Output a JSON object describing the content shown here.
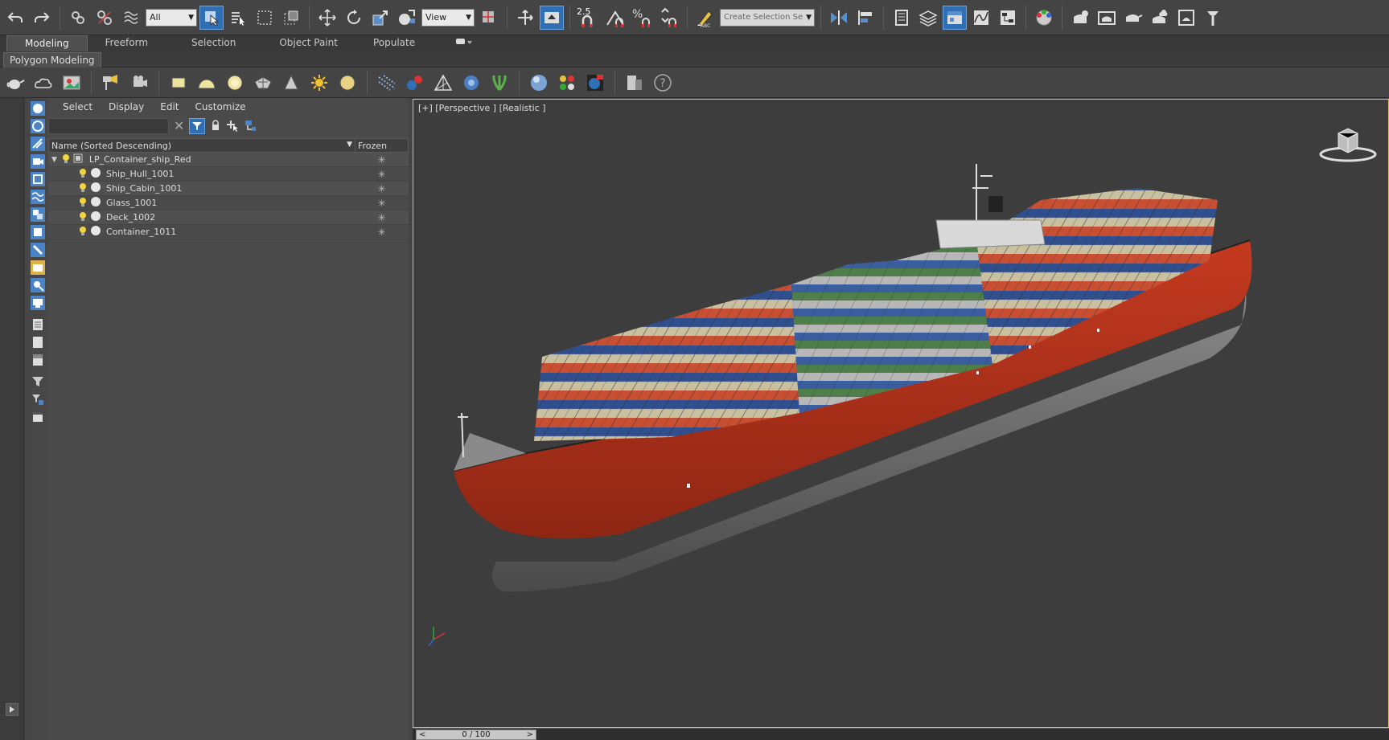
{
  "toolbar": {
    "selection_filter": "All",
    "ref_coord": "View",
    "snap_label": "2.5",
    "named_selection_placeholder": "Create Selection Se",
    "percent_snap": "%",
    "abc_label": "ABC",
    "icons": [
      "undo-icon",
      "redo-icon",
      "link-icon",
      "unlink-icon",
      "bind-space-warp-icon",
      "select-object-icon",
      "select-by-name-icon",
      "rect-region-icon",
      "window-crossing-icon",
      "select-move-icon",
      "select-rotate-icon",
      "select-scale-icon",
      "place-icon",
      "use-pivot-icon",
      "keyboard-shortcut-icon",
      "angle-snap-icon",
      "percent-snap-icon",
      "spinner-snap-icon",
      "edit-named-sets-icon",
      "mirror-icon",
      "align-icon",
      "scene-explorer-icon",
      "layer-explorer-icon",
      "ribbon-icon",
      "curve-editor-icon",
      "schematic-icon",
      "material-editor-icon",
      "render-setup-icon",
      "rendered-frame-icon",
      "render-icon",
      "render-cloud-icon",
      "a360-icon"
    ]
  },
  "ribbon": {
    "tabs": [
      "Modeling",
      "Freeform",
      "Selection",
      "Object Paint",
      "Populate"
    ],
    "active": "Modeling",
    "sub_label": "Polygon Modeling"
  },
  "explorer": {
    "menu": [
      "Select",
      "Display",
      "Edit",
      "Customize"
    ],
    "columns": [
      "Name (Sorted Descending)",
      "Frozen"
    ],
    "rows": [
      {
        "name": "LP_Container_ship_Red",
        "level": 0
      },
      {
        "name": "Ship_Hull_1001",
        "level": 1
      },
      {
        "name": "Ship_Cabin_1001",
        "level": 1
      },
      {
        "name": "Glass_1001",
        "level": 1
      },
      {
        "name": "Deck_1002",
        "level": 1
      },
      {
        "name": "Container_1011",
        "level": 1
      }
    ]
  },
  "viewport": {
    "label": "[+] [Perspective ] [Realistic ]"
  },
  "timeline": {
    "frame": "0 / 100",
    "prev": "<",
    "next": ">"
  },
  "colors": {
    "accent": "#2f6fb5",
    "viewport_border": "#d8c060",
    "hull_red": "#b5301b"
  }
}
